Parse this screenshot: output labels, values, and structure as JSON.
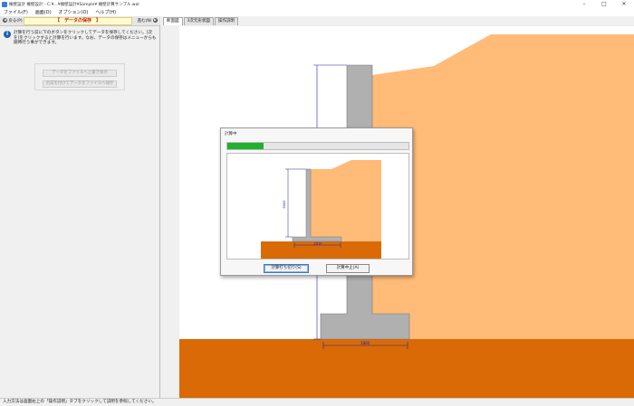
{
  "window": {
    "title": "擁壁設計 擁壁設計 - C:¥...¥擁壁設計¥Sample¥ 擁壁計算サンプル.wal"
  },
  "menu": [
    {
      "label": "ファイル(F)"
    },
    {
      "label": "画面(D)"
    },
    {
      "label": "オプション(O)"
    },
    {
      "label": "ヘルプ(H)"
    }
  ],
  "left_panel": {
    "prev_label": "戻る(P)",
    "next_label": "進む(N)",
    "heading": "【　データの保存　】",
    "info_text": "計算を行う前に下のボタンをクリックしてデータを保存してください。[次を]をクリックすると計算を行います。なお、データの保存はメニューからも随時行う事ができます。",
    "buttons": [
      {
        "label": "データをファイルへ上書き保存"
      },
      {
        "label": "名前を付けてデータをファイルへ保存"
      }
    ]
  },
  "tabs": [
    {
      "label": "断面図",
      "active": true
    },
    {
      "label": "3次元形状図",
      "active": false
    },
    {
      "label": "操作説明",
      "active": false
    }
  ],
  "drawing": {
    "dim_height_label": "6000",
    "dim_base_label": "1800",
    "colors": {
      "soil_backfill": "#ffbb77",
      "ground": "#d96a06",
      "wall": "#b0b0b0",
      "dimension": "#2020aa"
    }
  },
  "dialog": {
    "title": "計算中",
    "progress": 0.2,
    "progress_color": "#1fb12e",
    "preview_height_label": "6000",
    "preview_base_label": "2810",
    "start_label": "計算打ち切り(S)",
    "stop_label": "計算中止(A)"
  },
  "status_bar": {
    "text": "入力方法は画面右上の「操作説明」タブをクリックして説明を参照してください。"
  }
}
